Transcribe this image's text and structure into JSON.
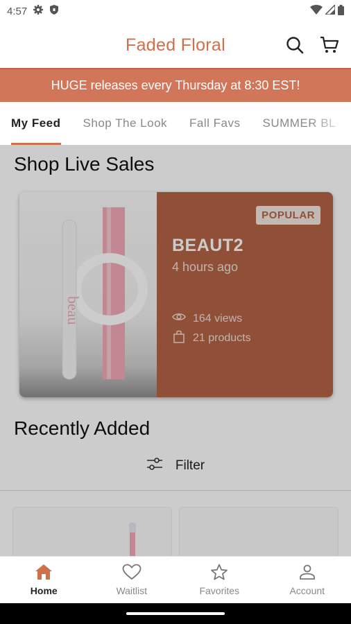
{
  "status_bar": {
    "time": "4:57"
  },
  "header": {
    "title": "Faded Floral"
  },
  "banner": {
    "text": "HUGE releases every Thursday at 8:30 EST!"
  },
  "tabs": [
    {
      "label": "My Feed",
      "active": true
    },
    {
      "label": "Shop The Look",
      "active": false
    },
    {
      "label": "Fall Favs",
      "active": false
    },
    {
      "label": "SUMMER BL",
      "active": false
    }
  ],
  "live_sales": {
    "section_title": "Shop Live Sales",
    "card": {
      "badge": "POPULAR",
      "name": "BEAUT2",
      "time": "4 hours ago",
      "views": "164 views",
      "products": "21 products",
      "image_text": "beau"
    }
  },
  "recently_added": {
    "section_title": "Recently Added",
    "filter_label": "Filter"
  },
  "bottom_nav": [
    {
      "label": "Home",
      "icon": "home-icon",
      "active": true
    },
    {
      "label": "Waitlist",
      "icon": "heart-icon",
      "active": false
    },
    {
      "label": "Favorites",
      "icon": "star-icon",
      "active": false
    },
    {
      "label": "Account",
      "icon": "person-icon",
      "active": false
    }
  ],
  "colors": {
    "brand": "#d06f4b",
    "banner": "#d2765a",
    "card": "#b56545"
  }
}
